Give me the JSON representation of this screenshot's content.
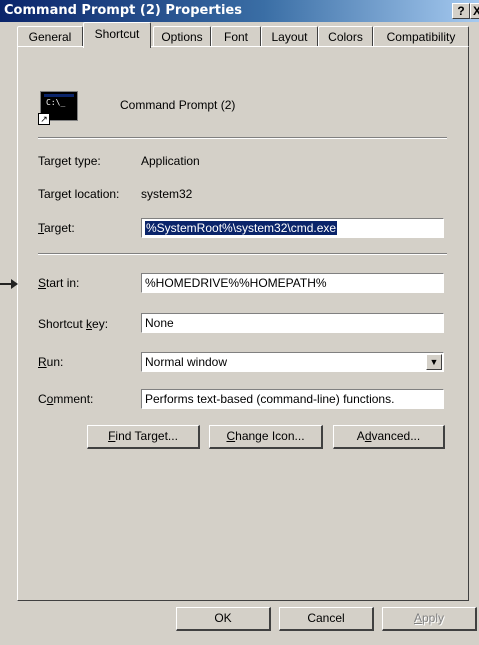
{
  "window": {
    "title": "Command Prompt (2) Properties",
    "help_glyph": "?",
    "close_glyph": "X"
  },
  "tabs": [
    {
      "label": "General"
    },
    {
      "label": "Shortcut"
    },
    {
      "label": "Options"
    },
    {
      "label": "Font"
    },
    {
      "label": "Layout"
    },
    {
      "label": "Colors"
    },
    {
      "label": "Compatibility"
    }
  ],
  "active_tab": "Shortcut",
  "shortcut": {
    "name": "Command Prompt (2)",
    "icon_text": "C:\\_",
    "target_type_label": "Target type:",
    "target_type_value": "Application",
    "target_location_label": "Target location:",
    "target_location_value": "system32",
    "target_label": "Target:",
    "target_label_accel": "T",
    "target_label_rest": "arget:",
    "target_value": "%SystemRoot%\\system32\\cmd.exe",
    "start_in_label_accel": "S",
    "start_in_label_rest": "tart in:",
    "start_in_value": "%HOMEDRIVE%%HOMEPATH%",
    "shortcut_key_label_pre": "Shortcut ",
    "shortcut_key_label_accel": "k",
    "shortcut_key_label_rest": "ey:",
    "shortcut_key_value": "None",
    "run_label_accel": "R",
    "run_label_rest": "un:",
    "run_value": "Normal window",
    "comment_label_pre": "C",
    "comment_label_accel": "o",
    "comment_label_rest": "mment:",
    "comment_value": "Performs text-based (command-line) functions."
  },
  "action_buttons": {
    "find_target_accel": "F",
    "find_target_rest": "ind Target...",
    "change_icon_accel": "C",
    "change_icon_rest": "hange Icon...",
    "advanced_pre": "A",
    "advanced_accel": "d",
    "advanced_rest": "vanced..."
  },
  "footer_buttons": {
    "ok": "OK",
    "cancel": "Cancel",
    "apply_accel": "A",
    "apply_rest": "pply"
  }
}
